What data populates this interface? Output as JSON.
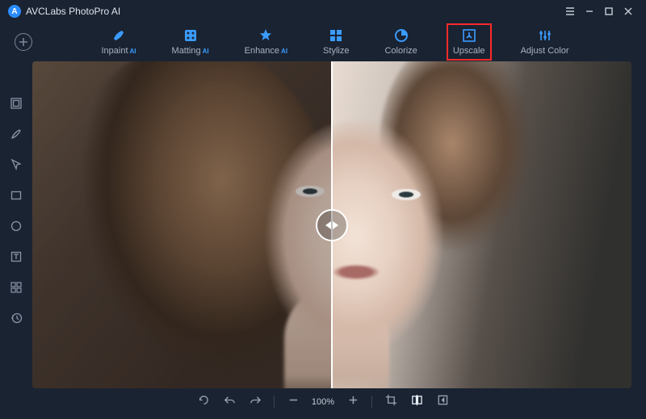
{
  "app": {
    "title": "AVCLabs PhotoPro AI"
  },
  "toolbar": {
    "tools": [
      {
        "label": "Inpaint",
        "ai": true,
        "icon": "inpaint"
      },
      {
        "label": "Matting",
        "ai": true,
        "icon": "matting"
      },
      {
        "label": "Enhance",
        "ai": true,
        "icon": "enhance"
      },
      {
        "label": "Stylize",
        "ai": false,
        "icon": "stylize"
      },
      {
        "label": "Colorize",
        "ai": false,
        "icon": "colorize"
      },
      {
        "label": "Upscale",
        "ai": false,
        "icon": "upscale",
        "highlighted": true
      },
      {
        "label": "Adjust Color",
        "ai": false,
        "icon": "adjust-color"
      }
    ]
  },
  "sidebar": {
    "items": [
      "layers",
      "brush",
      "pointer",
      "rectangle",
      "circle",
      "text",
      "grid",
      "history"
    ]
  },
  "zoom": {
    "value": "100%"
  },
  "bottombar": {
    "items": [
      "reset",
      "undo",
      "redo",
      "zoom-out",
      "zoom-value",
      "zoom-in",
      "crop",
      "compare",
      "export"
    ],
    "active": "compare"
  },
  "ai_tag": "AI"
}
